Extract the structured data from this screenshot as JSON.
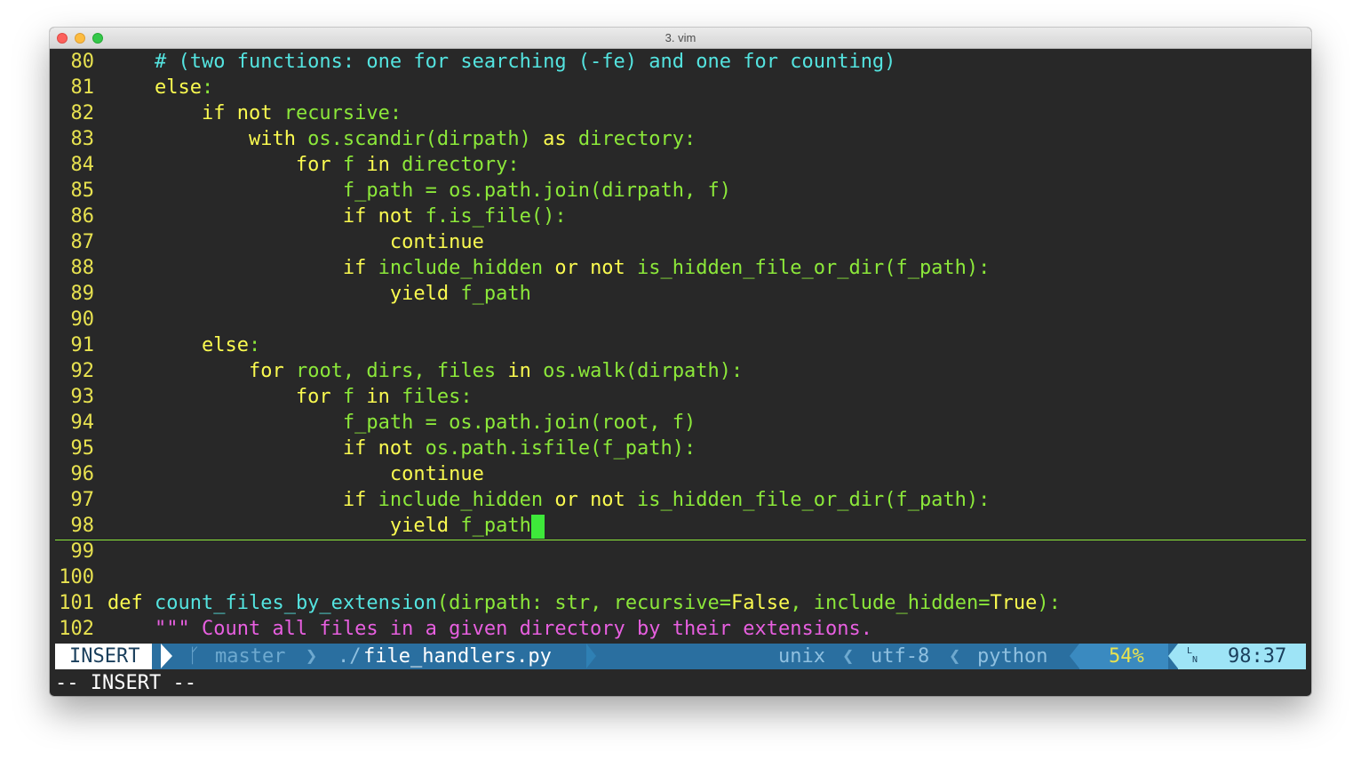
{
  "window": {
    "title": "3. vim"
  },
  "editor": {
    "lines": [
      {
        "num": "80",
        "tokens": [
          {
            "t": "    ",
            "c": "pl"
          },
          {
            "t": "# (two functions: one for searching (-fe) and one for counting)",
            "c": "cm"
          }
        ]
      },
      {
        "num": "81",
        "tokens": [
          {
            "t": "    ",
            "c": "pl"
          },
          {
            "t": "else",
            "c": "kw"
          },
          {
            "t": ":",
            "c": "id"
          }
        ]
      },
      {
        "num": "82",
        "tokens": [
          {
            "t": "        ",
            "c": "pl"
          },
          {
            "t": "if not",
            "c": "kw"
          },
          {
            "t": " recursive:",
            "c": "id"
          }
        ]
      },
      {
        "num": "83",
        "tokens": [
          {
            "t": "            ",
            "c": "pl"
          },
          {
            "t": "with",
            "c": "kw"
          },
          {
            "t": " os.scandir(dirpath) ",
            "c": "id"
          },
          {
            "t": "as",
            "c": "kw"
          },
          {
            "t": " directory:",
            "c": "id"
          }
        ]
      },
      {
        "num": "84",
        "tokens": [
          {
            "t": "                ",
            "c": "pl"
          },
          {
            "t": "for",
            "c": "kw"
          },
          {
            "t": " f ",
            "c": "id"
          },
          {
            "t": "in",
            "c": "kw"
          },
          {
            "t": " directory:",
            "c": "id"
          }
        ]
      },
      {
        "num": "85",
        "tokens": [
          {
            "t": "                    ",
            "c": "pl"
          },
          {
            "t": "f_path = os.path.join(dirpath, f)",
            "c": "id"
          }
        ]
      },
      {
        "num": "86",
        "tokens": [
          {
            "t": "                    ",
            "c": "pl"
          },
          {
            "t": "if not",
            "c": "kw"
          },
          {
            "t": " f.is_file():",
            "c": "id"
          }
        ]
      },
      {
        "num": "87",
        "tokens": [
          {
            "t": "                        ",
            "c": "pl"
          },
          {
            "t": "continue",
            "c": "kw"
          }
        ]
      },
      {
        "num": "88",
        "tokens": [
          {
            "t": "                    ",
            "c": "pl"
          },
          {
            "t": "if",
            "c": "kw"
          },
          {
            "t": " include_hidden ",
            "c": "id"
          },
          {
            "t": "or not",
            "c": "kw"
          },
          {
            "t": " is_hidden_file_or_dir(f_path):",
            "c": "id"
          }
        ]
      },
      {
        "num": "89",
        "tokens": [
          {
            "t": "                        ",
            "c": "pl"
          },
          {
            "t": "yield",
            "c": "kw"
          },
          {
            "t": " f_path",
            "c": "id"
          }
        ]
      },
      {
        "num": "90",
        "tokens": []
      },
      {
        "num": "91",
        "tokens": [
          {
            "t": "        ",
            "c": "pl"
          },
          {
            "t": "else",
            "c": "kw"
          },
          {
            "t": ":",
            "c": "id"
          }
        ]
      },
      {
        "num": "92",
        "tokens": [
          {
            "t": "            ",
            "c": "pl"
          },
          {
            "t": "for",
            "c": "kw"
          },
          {
            "t": " root, dirs, files ",
            "c": "id"
          },
          {
            "t": "in",
            "c": "kw"
          },
          {
            "t": " os.walk(dirpath):",
            "c": "id"
          }
        ]
      },
      {
        "num": "93",
        "tokens": [
          {
            "t": "                ",
            "c": "pl"
          },
          {
            "t": "for",
            "c": "kw"
          },
          {
            "t": " f ",
            "c": "id"
          },
          {
            "t": "in",
            "c": "kw"
          },
          {
            "t": " files:",
            "c": "id"
          }
        ]
      },
      {
        "num": "94",
        "tokens": [
          {
            "t": "                    ",
            "c": "pl"
          },
          {
            "t": "f_path = os.path.join(root, f)",
            "c": "id"
          }
        ]
      },
      {
        "num": "95",
        "tokens": [
          {
            "t": "                    ",
            "c": "pl"
          },
          {
            "t": "if not",
            "c": "kw"
          },
          {
            "t": " os.path.isfile(f_path):",
            "c": "id"
          }
        ]
      },
      {
        "num": "96",
        "tokens": [
          {
            "t": "                        ",
            "c": "pl"
          },
          {
            "t": "continue",
            "c": "kw"
          }
        ]
      },
      {
        "num": "97",
        "tokens": [
          {
            "t": "                    ",
            "c": "pl"
          },
          {
            "t": "if",
            "c": "kw"
          },
          {
            "t": " include_hidden ",
            "c": "id"
          },
          {
            "t": "or not",
            "c": "kw"
          },
          {
            "t": " is_hidden_file_or_dir(f_path):",
            "c": "id"
          }
        ]
      },
      {
        "num": "98",
        "tokens": [
          {
            "t": "                        ",
            "c": "pl"
          },
          {
            "t": "yield",
            "c": "kw"
          },
          {
            "t": " f_path",
            "c": "id"
          }
        ],
        "cursor": true
      },
      {
        "num": "99",
        "tokens": []
      },
      {
        "num": "100",
        "tokens": []
      },
      {
        "num": "101",
        "tokens": [
          {
            "t": "def",
            "c": "kw"
          },
          {
            "t": " ",
            "c": "pl"
          },
          {
            "t": "count_files_by_extension",
            "c": "fn"
          },
          {
            "t": "(dirpath: str, recursive=",
            "c": "id"
          },
          {
            "t": "False",
            "c": "kw"
          },
          {
            "t": ", include_hidden=",
            "c": "id"
          },
          {
            "t": "True",
            "c": "kw"
          },
          {
            "t": "):",
            "c": "id"
          }
        ]
      },
      {
        "num": "102",
        "tokens": [
          {
            "t": "    ",
            "c": "pl"
          },
          {
            "t": "\"\"\" Count all files in a given directory by their extensions.",
            "c": "str"
          }
        ]
      }
    ]
  },
  "statusline": {
    "mode": "INSERT",
    "branch_icon": "git-branch-icon",
    "branch": "master",
    "sep": "❯",
    "file_dir": "./",
    "file_name": "file_handlers.py",
    "format": "unix",
    "encoding": "utf-8",
    "filetype": "python",
    "rsep": "❮",
    "percent": "54%",
    "ln_icon": "line-number-icon",
    "position": "98:37"
  },
  "cmdline": {
    "text": "-- INSERT --"
  },
  "colors": {
    "keyword": "#fafa50",
    "identifier": "#8ce83a",
    "function": "#54e4e0",
    "comment": "#54e4e0",
    "string": "#e85fe0",
    "background": "#282828",
    "cursor": "#3ee83a",
    "status_bar": "#2a6fa0"
  }
}
